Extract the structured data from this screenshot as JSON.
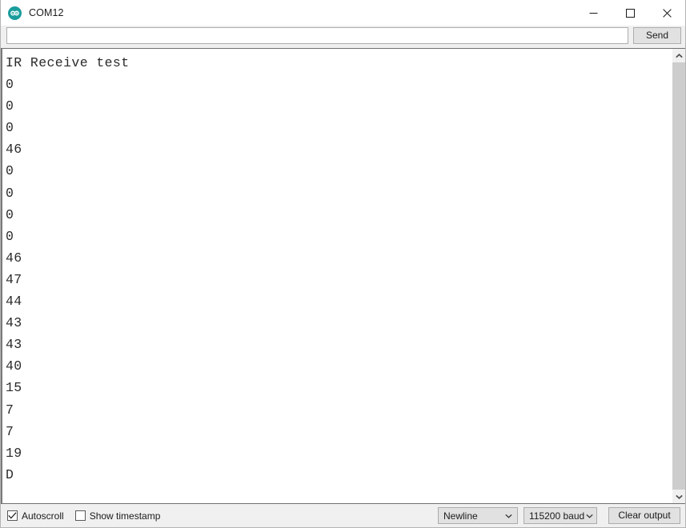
{
  "window": {
    "title": "COM12",
    "icon": "arduino-infinity-icon",
    "controls": {
      "minimize": "minimize-icon",
      "maximize": "maximize-icon",
      "close": "close-icon"
    }
  },
  "send_row": {
    "input_value": "",
    "input_placeholder": "",
    "send_label": "Send"
  },
  "output": {
    "lines": [
      "IR Receive test",
      "0",
      "0",
      "0",
      "46",
      "0",
      "0",
      "0",
      "0",
      "46",
      "47",
      "44",
      "43",
      "43",
      "40",
      "15",
      "7",
      "7",
      "19",
      "D"
    ]
  },
  "scrollbar": {
    "up_arrow": "chevron-up-icon",
    "down_arrow": "chevron-down-icon"
  },
  "bottom_bar": {
    "autoscroll_label": "Autoscroll",
    "autoscroll_checked": true,
    "timestamp_label": "Show timestamp",
    "timestamp_checked": false,
    "line_ending": "Newline",
    "baud_rate": "115200 baud",
    "clear_label": "Clear output"
  },
  "colors": {
    "accent": "#1a9c9c",
    "panel": "#f0f0f0",
    "text": "#1b1b1b",
    "output_text": "#2b2b2b",
    "scroll_thumb": "#cdcdcd",
    "border": "#707070"
  }
}
